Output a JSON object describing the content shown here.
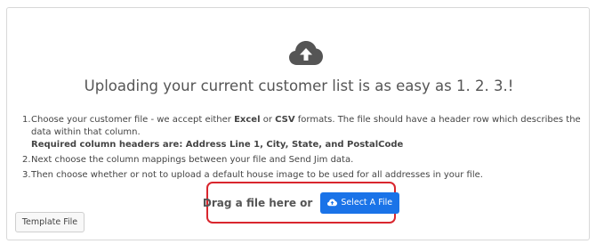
{
  "upload_panel": {
    "headline": "Uploading your current customer list is as easy as 1. 2. 3.!",
    "icon": "cloud-upload-icon",
    "steps": [
      {
        "number": "1.",
        "text_before": "Choose your customer file - we accept either ",
        "format_1": "Excel",
        "text_or": " or ",
        "format_2": "CSV",
        "text_after": " formats. The file should have a header row which describes the data within that column.",
        "required": "Required column headers are: Address Line 1, City, State, and PostalCode"
      },
      {
        "number": "2.",
        "text": "Next choose the column mappings between your file and Send Jim data."
      },
      {
        "number": "3.",
        "text": "Then choose whether or not to upload a default house image to be used for all addresses in your file."
      }
    ],
    "dropzone": {
      "label": "Drag a file here or",
      "button_label": "Select A File",
      "button_icon": "cloud-upload-small-icon"
    },
    "template_button": "Template File"
  },
  "colors": {
    "button_primary": "#1a73e8",
    "dropzone_border": "#d9262e",
    "cloud_icon": "#555555"
  }
}
